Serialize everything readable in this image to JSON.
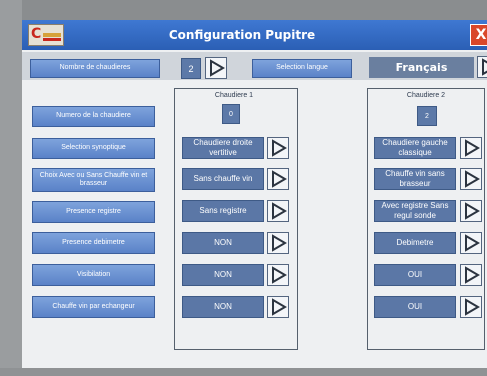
{
  "window": {
    "title": "Configuration Pupitre",
    "close_label": "X"
  },
  "toolbar": {
    "boiler_count_label": "Nombre de chaudieres",
    "boiler_count_value": "2",
    "language_label": "Selection langue",
    "language_value": "Français"
  },
  "left_menu": [
    "Numero de la chaudiere",
    "Selection synoptique",
    "Choix Avec ou Sans Chauffe vin et brasseur",
    "Presence registre",
    "Presence debimetre",
    "Visibilation",
    "Chauffe vin par echangeur"
  ],
  "boilers": [
    {
      "title": "Chaudiere 1",
      "number": "0",
      "options": [
        "Chaudiere droite vertitive",
        "Sans chauffe vin",
        "Sans registre",
        "NON",
        "NON",
        "NON"
      ]
    },
    {
      "title": "Chaudiere 2",
      "number": "2",
      "options": [
        "Chaudiere gauche classique",
        "Chauffe vin sans brasseur",
        "Avec registre Sans regul sonde",
        "Debimetre",
        "OUI",
        "OUI"
      ]
    }
  ],
  "colors": {
    "titlebar": "#3f78d2",
    "button": "#6a91d2",
    "option_box": "#5b77a6",
    "close": "#d9472a"
  },
  "icons": {
    "next": "play-triangle-icon",
    "logo": "app-logo"
  }
}
